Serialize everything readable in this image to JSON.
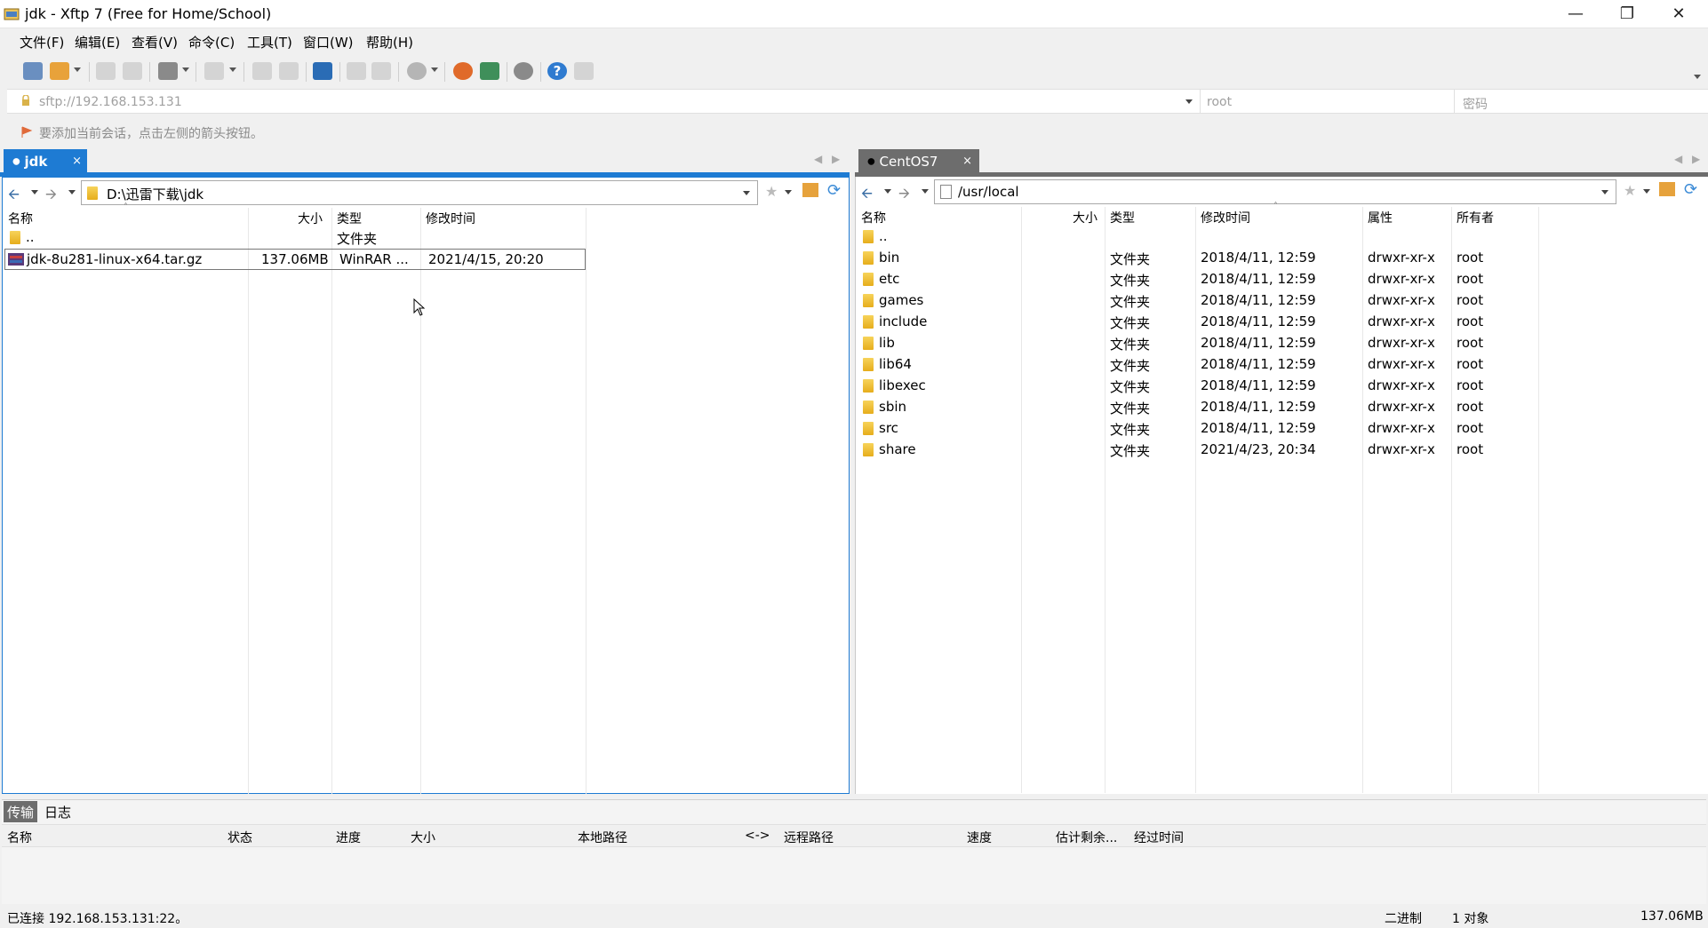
{
  "window": {
    "title": "jdk - Xftp 7 (Free for Home/School)"
  },
  "menu": [
    "文件(F)",
    "编辑(E)",
    "查看(V)",
    "命令(C)",
    "工具(T)",
    "窗口(W)",
    "帮助(H)"
  ],
  "address": {
    "host": "sftp://192.168.153.131",
    "user": "root",
    "password": "密码"
  },
  "hint": "要添加当前会话，点击左侧的箭头按钮。",
  "local": {
    "tab": "jdk",
    "path": "D:\\迅雷下载\\jdk",
    "columns": {
      "name": "名称",
      "size": "大小",
      "type": "类型",
      "modified": "修改时间"
    },
    "rows": [
      {
        "name": "..",
        "size": "",
        "type": "文件夹",
        "modified": ""
      },
      {
        "name": "jdk-8u281-linux-x64.tar.gz",
        "size": "137.06MB",
        "type": "WinRAR ...",
        "modified": "2021/4/15, 20:20"
      }
    ]
  },
  "remote": {
    "tab": "CentOS7",
    "path": "/usr/local",
    "columns": {
      "name": "名称",
      "size": "大小",
      "type": "类型",
      "modified": "修改时间",
      "attr": "属性",
      "owner": "所有者"
    },
    "rows": [
      {
        "name": "..",
        "type": "",
        "modified": "",
        "attr": "",
        "owner": ""
      },
      {
        "name": "bin",
        "type": "文件夹",
        "modified": "2018/4/11, 12:59",
        "attr": "drwxr-xr-x",
        "owner": "root"
      },
      {
        "name": "etc",
        "type": "文件夹",
        "modified": "2018/4/11, 12:59",
        "attr": "drwxr-xr-x",
        "owner": "root"
      },
      {
        "name": "games",
        "type": "文件夹",
        "modified": "2018/4/11, 12:59",
        "attr": "drwxr-xr-x",
        "owner": "root"
      },
      {
        "name": "include",
        "type": "文件夹",
        "modified": "2018/4/11, 12:59",
        "attr": "drwxr-xr-x",
        "owner": "root"
      },
      {
        "name": "lib",
        "type": "文件夹",
        "modified": "2018/4/11, 12:59",
        "attr": "drwxr-xr-x",
        "owner": "root"
      },
      {
        "name": "lib64",
        "type": "文件夹",
        "modified": "2018/4/11, 12:59",
        "attr": "drwxr-xr-x",
        "owner": "root"
      },
      {
        "name": "libexec",
        "type": "文件夹",
        "modified": "2018/4/11, 12:59",
        "attr": "drwxr-xr-x",
        "owner": "root"
      },
      {
        "name": "sbin",
        "type": "文件夹",
        "modified": "2018/4/11, 12:59",
        "attr": "drwxr-xr-x",
        "owner": "root"
      },
      {
        "name": "src",
        "type": "文件夹",
        "modified": "2018/4/11, 12:59",
        "attr": "drwxr-xr-x",
        "owner": "root"
      },
      {
        "name": "share",
        "type": "文件夹",
        "modified": "2021/4/23, 20:34",
        "attr": "drwxr-xr-x",
        "owner": "root"
      }
    ]
  },
  "bottom_tabs": {
    "transfer": "传输",
    "log": "日志"
  },
  "transfer_columns": {
    "name": "名称",
    "status": "状态",
    "progress": "进度",
    "size": "大小",
    "local_path": "本地路径",
    "arrow": "<->",
    "remote_path": "远程路径",
    "speed": "速度",
    "eta": "估计剩余...",
    "elapsed": "经过时间"
  },
  "status": {
    "connection": "已连接 192.168.153.131:22。",
    "mode": "二进制",
    "objects": "1 对象",
    "size": "137.06MB"
  },
  "colors": {
    "tab_active": "#1e7bd3",
    "tab_remote": "#6d6d6d",
    "accent_line": "#1e7bd3"
  }
}
